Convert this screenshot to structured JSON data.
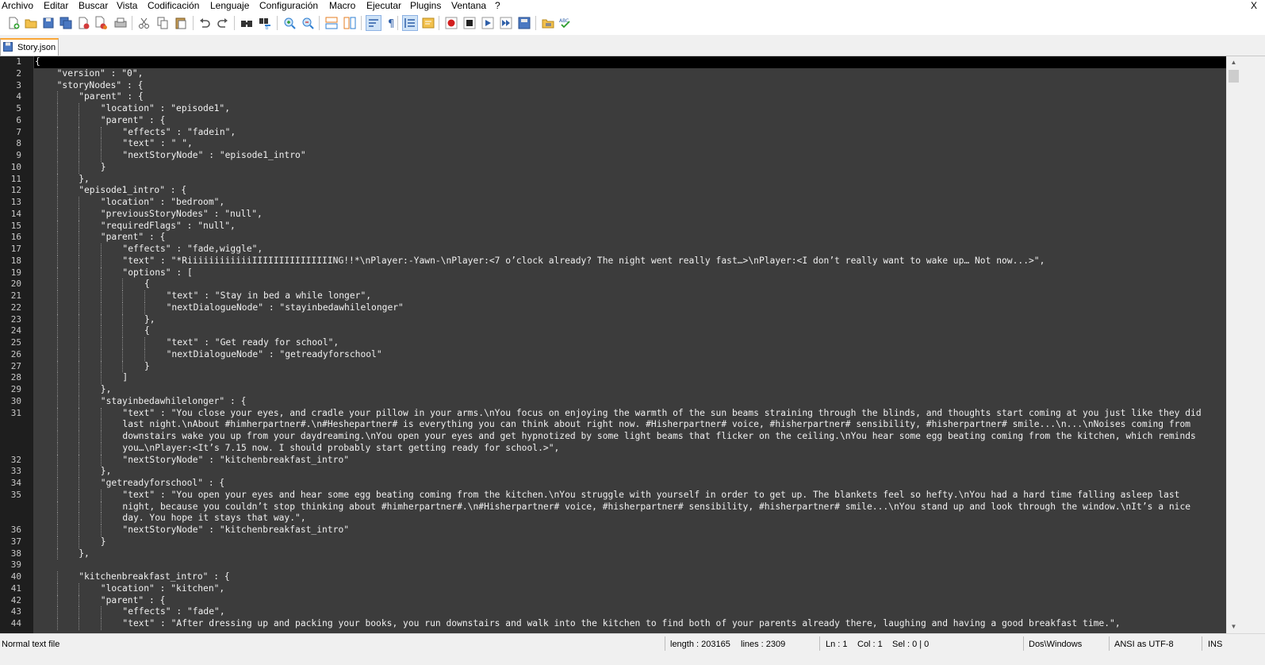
{
  "menu": {
    "items": [
      "Archivo",
      "Editar",
      "Buscar",
      "Vista",
      "Codificación",
      "Lenguaje",
      "Configuración",
      "Macro",
      "Ejecutar",
      "Plugins",
      "Ventana",
      "?"
    ],
    "close": "X"
  },
  "toolbar": {
    "buttons": [
      "new-file",
      "open-file",
      "save",
      "save-all",
      "close",
      "close-all",
      "print",
      "cut",
      "copy",
      "paste",
      "undo",
      "redo",
      "find",
      "replace",
      "zoom-in",
      "zoom-out",
      "sync-vertical",
      "sync-horizontal",
      "word-wrap",
      "show-all-characters",
      "indent-guide",
      "document-map",
      "record-macro",
      "stop-recording",
      "play-macro",
      "run-macro-multiple",
      "save-macro",
      "folder-as-workspace",
      "spell-check"
    ]
  },
  "tab": {
    "label": "Story.json",
    "accent": "#f9a637"
  },
  "editor": {
    "background": "#3c3c3c",
    "gutter_background": "#1e1e1e",
    "current_line_background": "#000000",
    "line_numbers": [
      "1",
      "2",
      "3",
      "4",
      "5",
      "6",
      "7",
      "8",
      "9",
      "10",
      "11",
      "12",
      "13",
      "14",
      "15",
      "16",
      "17",
      "18",
      "19",
      "20",
      "21",
      "22",
      "23",
      "24",
      "25",
      "26",
      "27",
      "28",
      "29",
      "30",
      "31",
      "",
      "",
      "",
      "32",
      "33",
      "34",
      "35",
      "",
      "",
      "36",
      "37",
      "38",
      "39",
      "40",
      "41",
      "42",
      "43",
      "44"
    ],
    "rows": [
      {
        "indent": 0,
        "text": "{"
      },
      {
        "indent": 1,
        "text": "\"version\" : \"0\","
      },
      {
        "indent": 1,
        "text": "\"storyNodes\" : {"
      },
      {
        "indent": 2,
        "text": "\"parent\" : {"
      },
      {
        "indent": 3,
        "text": "\"location\" : \"episode1\","
      },
      {
        "indent": 3,
        "text": "\"parent\" : {"
      },
      {
        "indent": 4,
        "text": "\"effects\" : \"fadein\","
      },
      {
        "indent": 4,
        "text": "\"text\" : \" \","
      },
      {
        "indent": 4,
        "text": "\"nextStoryNode\" : \"episode1_intro\""
      },
      {
        "indent": 3,
        "text": "}"
      },
      {
        "indent": 2,
        "text": "},"
      },
      {
        "indent": 2,
        "text": "\"episode1_intro\" : {"
      },
      {
        "indent": 3,
        "text": "\"location\" : \"bedroom\","
      },
      {
        "indent": 3,
        "text": "\"previousStoryNodes\" : \"null\","
      },
      {
        "indent": 3,
        "text": "\"requiredFlags\" : \"null\","
      },
      {
        "indent": 3,
        "text": "\"parent\" : {"
      },
      {
        "indent": 4,
        "text": "\"effects\" : \"fade,wiggle\","
      },
      {
        "indent": 4,
        "text": "\"text\" : \"*RiiiiiiiiiiiiIIIIIIIIIIIIIIING!!*\\nPlayer:-Yawn-\\nPlayer:<7 o’clock already? The night went really fast…>\\nPlayer:<I don’t really want to wake up… Not now...>\","
      },
      {
        "indent": 4,
        "text": "\"options\" : ["
      },
      {
        "indent": 5,
        "text": "{"
      },
      {
        "indent": 6,
        "text": "\"text\" : \"Stay in bed a while longer\","
      },
      {
        "indent": 6,
        "text": "\"nextDialogueNode\" : \"stayinbedawhilelonger\""
      },
      {
        "indent": 5,
        "text": "},"
      },
      {
        "indent": 5,
        "text": "{"
      },
      {
        "indent": 6,
        "text": "\"text\" : \"Get ready for school\","
      },
      {
        "indent": 6,
        "text": "\"nextDialogueNode\" : \"getreadyforschool\""
      },
      {
        "indent": 5,
        "text": "}"
      },
      {
        "indent": 4,
        "text": "]"
      },
      {
        "indent": 3,
        "text": "},"
      },
      {
        "indent": 3,
        "text": "\"stayinbedawhilelonger\" : {"
      },
      {
        "indent": 4,
        "text": "\"text\" : \"You close your eyes, and cradle your pillow in your arms.\\nYou focus on enjoying the warmth of the sun beams straining through the blinds, and thoughts start coming at you just like they did"
      },
      {
        "indent": 4,
        "text": "last night.\\nAbout #himherpartner#.\\n#Heshepartner# is everything you can think about right now. #Hisherpartner# voice, #hisherpartner# sensibility, #hisherpartner# smile...\\n...\\nNoises coming from"
      },
      {
        "indent": 4,
        "text": "downstairs wake you up from your daydreaming.\\nYou open your eyes and get hypnotized by some light beams that flicker on the ceiling.\\nYou hear some egg beating coming from the kitchen, which reminds"
      },
      {
        "indent": 4,
        "text": "you…\\nPlayer:<It’s 7.15 now. I should probably start getting ready for school.>\","
      },
      {
        "indent": 4,
        "text": "\"nextStoryNode\" : \"kitchenbreakfast_intro\""
      },
      {
        "indent": 3,
        "text": "},"
      },
      {
        "indent": 3,
        "text": "\"getreadyforschool\" : {"
      },
      {
        "indent": 4,
        "text": "\"text\" : \"You open your eyes and hear some egg beating coming from the kitchen.\\nYou struggle with yourself in order to get up. The blankets feel so hefty.\\nYou had a hard time falling asleep last"
      },
      {
        "indent": 4,
        "text": "night, because you couldn’t stop thinking about #himherpartner#.\\n#Hisherpartner# voice, #hisherpartner# sensibility, #hisherpartner# smile...\\nYou stand up and look through the window.\\nIt’s a nice"
      },
      {
        "indent": 4,
        "text": "day. You hope it stays that way.\","
      },
      {
        "indent": 4,
        "text": "\"nextStoryNode\" : \"kitchenbreakfast_intro\""
      },
      {
        "indent": 3,
        "text": "}"
      },
      {
        "indent": 2,
        "text": "},"
      },
      {
        "indent": 0,
        "text": ""
      },
      {
        "indent": 2,
        "text": "\"kitchenbreakfast_intro\" : {"
      },
      {
        "indent": 3,
        "text": "\"location\" : \"kitchen\","
      },
      {
        "indent": 3,
        "text": "\"parent\" : {"
      },
      {
        "indent": 4,
        "text": "\"effects\" : \"fade\","
      },
      {
        "indent": 4,
        "text": "\"text\" : \"After dressing up and packing your books, you run downstairs and walk into the kitchen to find both of your parents already there, laughing and having a good breakfast time.\","
      }
    ]
  },
  "status": {
    "file_type": "Normal text file",
    "length": "length : 203165",
    "lines": "lines : 2309",
    "ln": "Ln : 1",
    "col": "Col : 1",
    "sel": "Sel : 0 | 0",
    "eol": "Dos\\Windows",
    "encoding": "ANSI as UTF-8",
    "mode": "INS"
  }
}
